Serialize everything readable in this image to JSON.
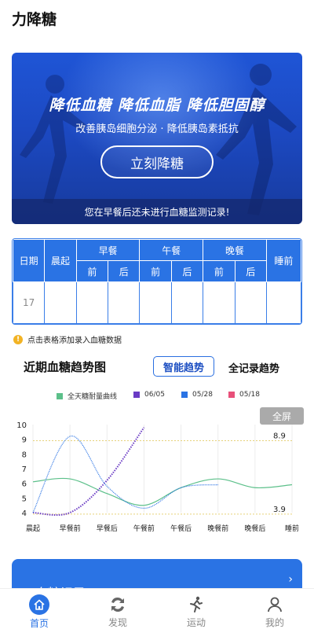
{
  "app": {
    "title": "力降糖"
  },
  "banner": {
    "headline": "降低血糖 降低血脂 降低胆固醇",
    "subtitle": "改善胰岛细胞分泌 · 降低胰岛素抵抗",
    "button_label": "立刻降糖",
    "notice": "您在早餐后还未进行血糖监测记录!"
  },
  "table": {
    "headers": {
      "date": "日期",
      "wake": "晨起",
      "breakfast": "早餐",
      "lunch": "午餐",
      "dinner": "晚餐",
      "bedtime": "睡前",
      "before": "前",
      "after": "后"
    },
    "rows": [
      {
        "date": "17"
      }
    ]
  },
  "hint": {
    "icon": "info-icon",
    "text": "点击表格添加录入血糖数据"
  },
  "trend": {
    "title": "近期血糖趋势图",
    "tab_smart": "智能趋势",
    "tab_all": "全记录趋势",
    "fullscreen": "全屏"
  },
  "chart_data": {
    "type": "line",
    "categories": [
      "晨起",
      "早餐前",
      "早餐后",
      "午餐前",
      "午餐后",
      "晚餐前",
      "晚餐后",
      "睡前"
    ],
    "yticks": [
      4,
      5,
      6,
      7,
      8,
      9,
      10
    ],
    "ylim": [
      4,
      10
    ],
    "reference_lines": [
      {
        "value": 8.9,
        "label": "8.9",
        "color": "#e6d27a"
      },
      {
        "value": 3.9,
        "label": "3.9",
        "color": "#e6d27a"
      }
    ],
    "series": [
      {
        "name": "全天糖耐量曲线",
        "color": "#5cc08a",
        "style": "solid",
        "values": [
          6.1,
          6.3,
          5.3,
          4.5,
          5.7,
          6.3,
          5.7,
          5.9
        ]
      },
      {
        "name": "06/05",
        "color": "#6a3bc4",
        "style": "dotted",
        "values": [
          4.0,
          4.0,
          6.2,
          9.8,
          null,
          null,
          null,
          null
        ]
      },
      {
        "name": "05/28",
        "color": "#2a73e4",
        "style": "solid",
        "values": [
          4.0,
          9.2,
          5.8,
          4.3,
          5.7,
          5.9,
          null,
          null
        ]
      },
      {
        "name": "05/18",
        "color": "#e8507a",
        "style": "solid",
        "values": []
      }
    ]
  },
  "record": {
    "label": "血糖记录",
    "arrow": "›"
  },
  "nav": {
    "items": [
      {
        "label": "首页",
        "icon": "home-icon",
        "active": true
      },
      {
        "label": "发现",
        "icon": "discover-icon",
        "active": false
      },
      {
        "label": "运动",
        "icon": "exercise-icon",
        "active": false
      },
      {
        "label": "我的",
        "icon": "user-icon",
        "active": false
      }
    ]
  },
  "colors": {
    "primary": "#2a73e4",
    "banner": "#1f55d6",
    "hint_icon": "#f2b324"
  }
}
